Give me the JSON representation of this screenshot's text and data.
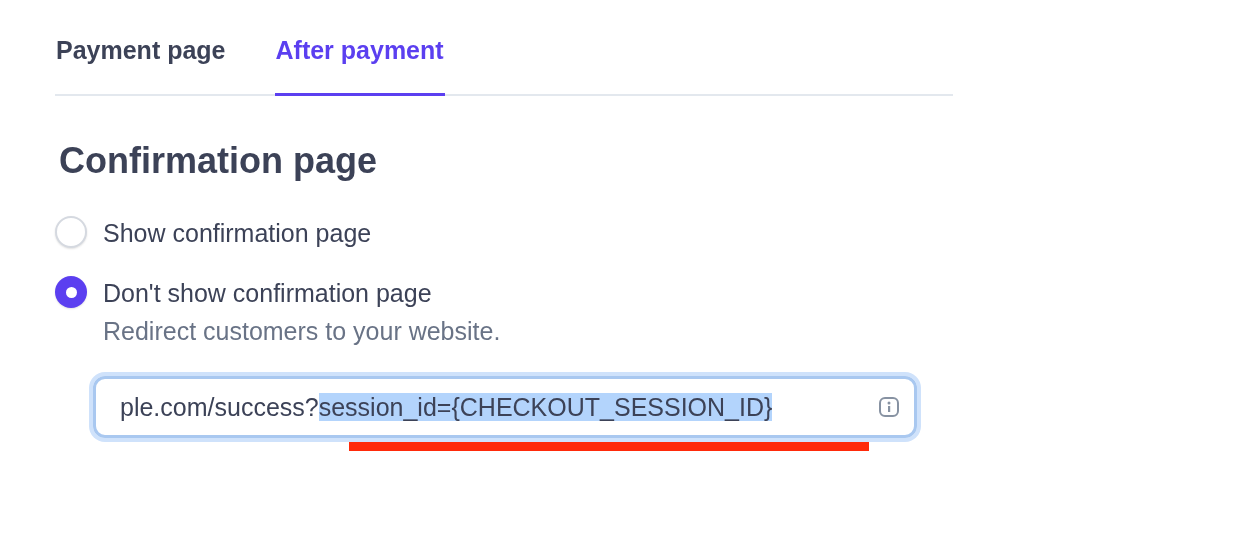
{
  "tabs": [
    {
      "label": "Payment page",
      "selected": false
    },
    {
      "label": "After payment",
      "selected": true
    }
  ],
  "section": {
    "title": "Confirmation page",
    "options": [
      {
        "label": "Show confirmation page",
        "selected": false
      },
      {
        "label": "Don't show confirmation page",
        "selected": true,
        "description": "Redirect customers to your website."
      }
    ],
    "url_field": {
      "value_before_selection": "ple.com/success?",
      "selected_value": "session_id={CHECKOUT_SESSION_ID}",
      "underlined": true
    }
  }
}
